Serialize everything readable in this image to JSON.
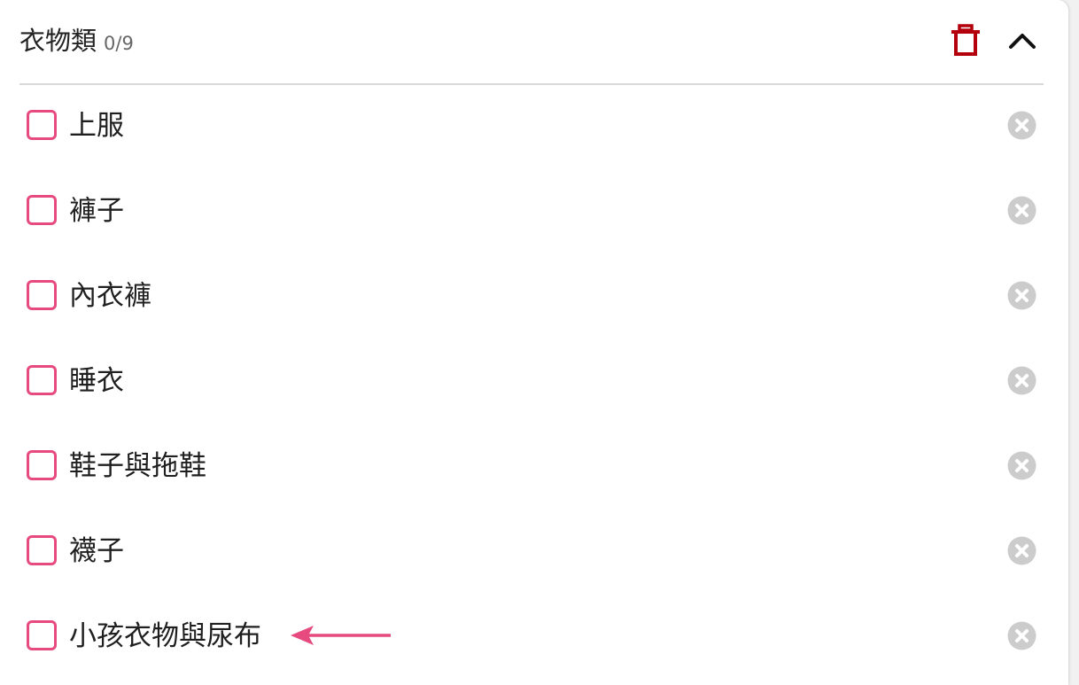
{
  "header": {
    "title": "衣物類",
    "count": "0/9"
  },
  "items": [
    {
      "label": "上服"
    },
    {
      "label": "褲子"
    },
    {
      "label": "內衣褲"
    },
    {
      "label": "睡衣"
    },
    {
      "label": "鞋子與拖鞋"
    },
    {
      "label": "襪子"
    },
    {
      "label": "小孩衣物與尿布"
    }
  ],
  "colors": {
    "accent": "#e64a7f",
    "trash": "#b3000c",
    "remove_icon": "#cccccc"
  },
  "icons": {
    "delete": "trash-icon",
    "collapse": "chevron-up-icon",
    "remove": "close-circle-icon",
    "annotation": "arrow-left-icon"
  }
}
